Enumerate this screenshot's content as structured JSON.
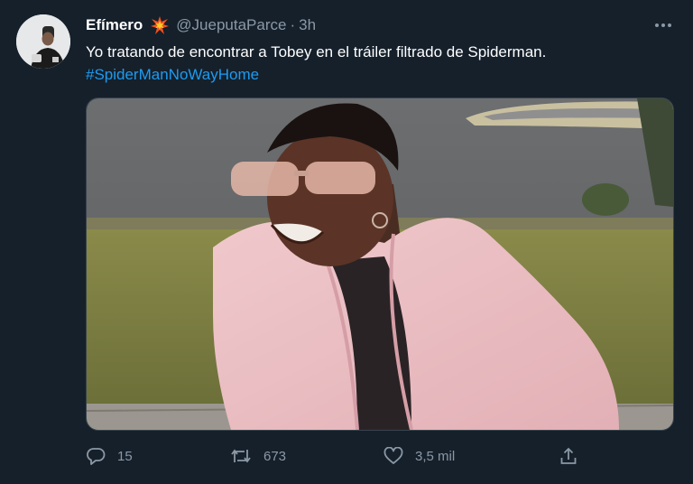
{
  "tweet": {
    "display_name": "Efímero",
    "handle": "@JueputaParce",
    "separator": "·",
    "timestamp": "3h",
    "text": "Yo tratando de encontrar a Tobey en el tráiler filtrado de Spiderman.",
    "hashtag": "#SpiderManNoWayHome"
  },
  "actions": {
    "replies": "15",
    "retweets": "673",
    "likes": "3,5 mil"
  },
  "icons": {
    "name_emoji": "collision-emoji-icon",
    "more": "more-options-icon",
    "reply": "reply-icon",
    "retweet": "retweet-icon",
    "like": "heart-icon",
    "share": "share-icon"
  },
  "colors": {
    "background": "#15202b",
    "text": "#ffffff",
    "secondary": "#8b98a5",
    "link": "#1d9bf0"
  }
}
